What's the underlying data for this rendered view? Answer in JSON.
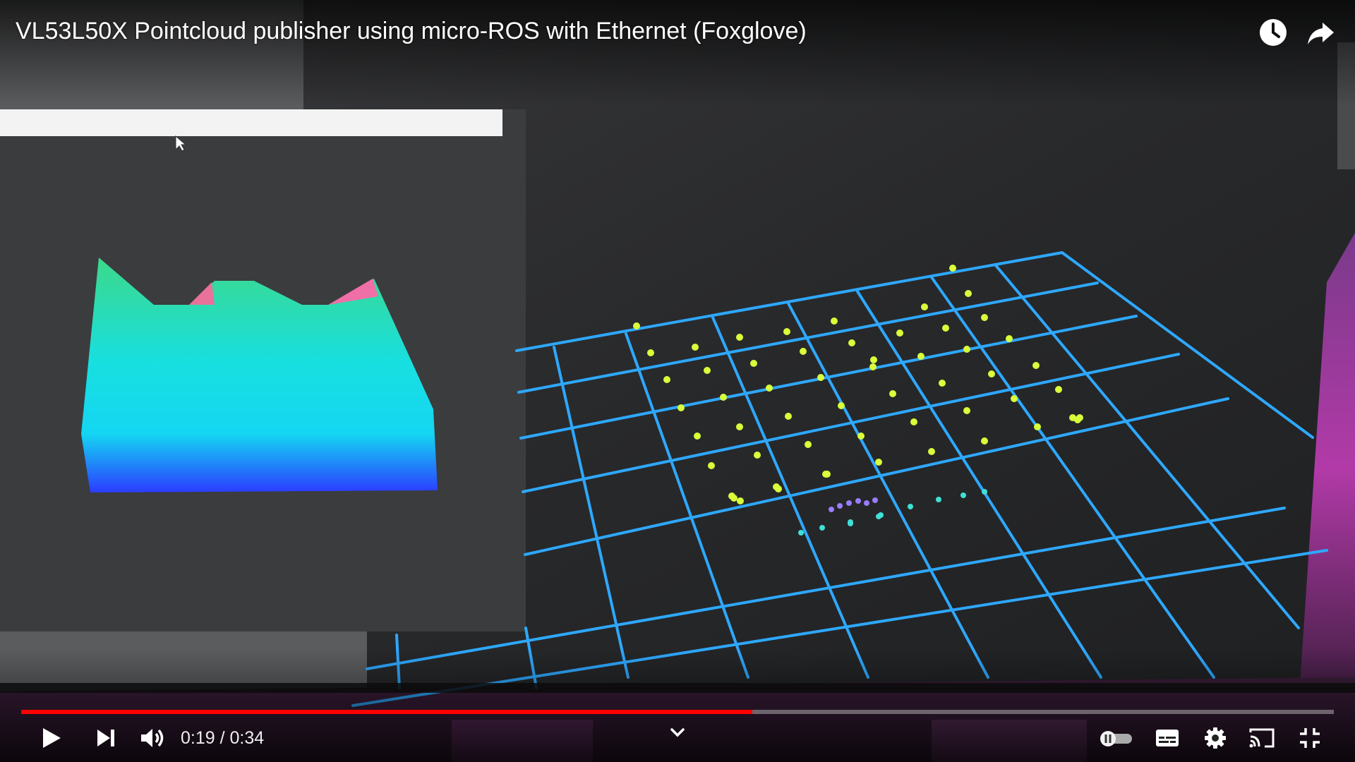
{
  "video": {
    "title": "VL53L50X Pointcloud publisher using micro-ROS with Ethernet (Foxglove)",
    "current_time": "0:19",
    "separator": " / ",
    "duration": "0:34",
    "progress_fraction": 0.557
  },
  "top_actions": {
    "watch_later_icon": "clock-icon",
    "share_icon": "share-arrow-icon"
  },
  "controls": {
    "play_icon": "play-icon",
    "next_icon": "next-icon",
    "volume_icon": "volume-icon",
    "autoplay_icon": "autoplay-toggle-icon",
    "subtitles_icon": "subtitles-icon",
    "settings_icon": "gear-icon",
    "cast_icon": "cast-icon",
    "exit_fullscreen_icon": "exit-fullscreen-icon",
    "chevron_icon": "chevron-down-icon"
  },
  "colors": {
    "progress": "#ff0000",
    "grid": "#2ea8ff",
    "points": "#d8ff3a",
    "surface_top": "#3ddc8a",
    "surface_bottom": "#2a4bff"
  }
}
